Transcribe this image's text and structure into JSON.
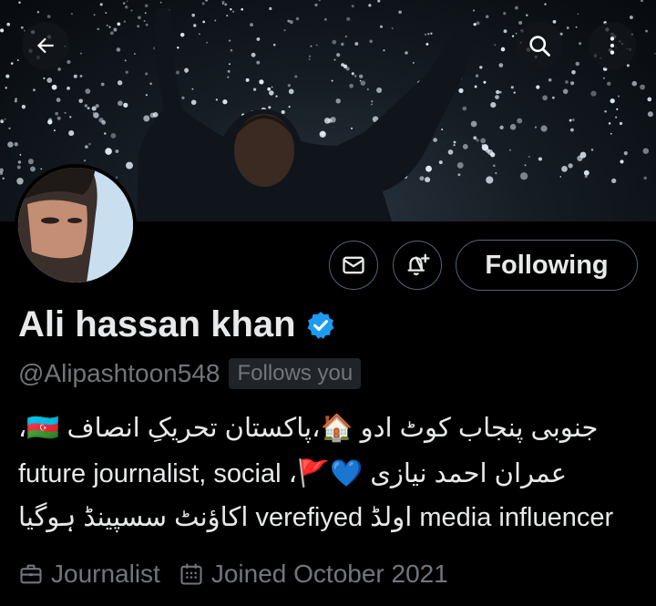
{
  "nav": {
    "back_icon": "arrow-left-icon",
    "search_icon": "search-icon",
    "more_icon": "more-vertical-icon"
  },
  "actions": {
    "message_icon": "mail-icon",
    "notify_icon": "bell-plus-icon",
    "follow_label": "Following"
  },
  "profile": {
    "name": "Ali hassan khan",
    "verified": true,
    "handle": "@Alipashtoon548",
    "follows_you_label": "Follows you"
  },
  "bio": {
    "line1": "جنوبی پنجاب کوٹ ادو 🏠،پاکستان تحریکِ انصاف 🇦🇿،",
    "line2": "عمران احمد نیازی 💙🚩، future journalist, social",
    "line3": "media influencer اولڈ verefiyed اکاؤنٹ سسپینڈ ہوگیا"
  },
  "meta": {
    "profession": "Journalist",
    "profession_icon": "briefcase-icon",
    "joined": "Joined October 2021",
    "joined_icon": "calendar-icon"
  },
  "colors": {
    "background": "#000000",
    "text_primary": "#e7e9ea",
    "text_secondary": "#71767b",
    "verified_blue": "#1d9bf0",
    "border": "#536471"
  }
}
